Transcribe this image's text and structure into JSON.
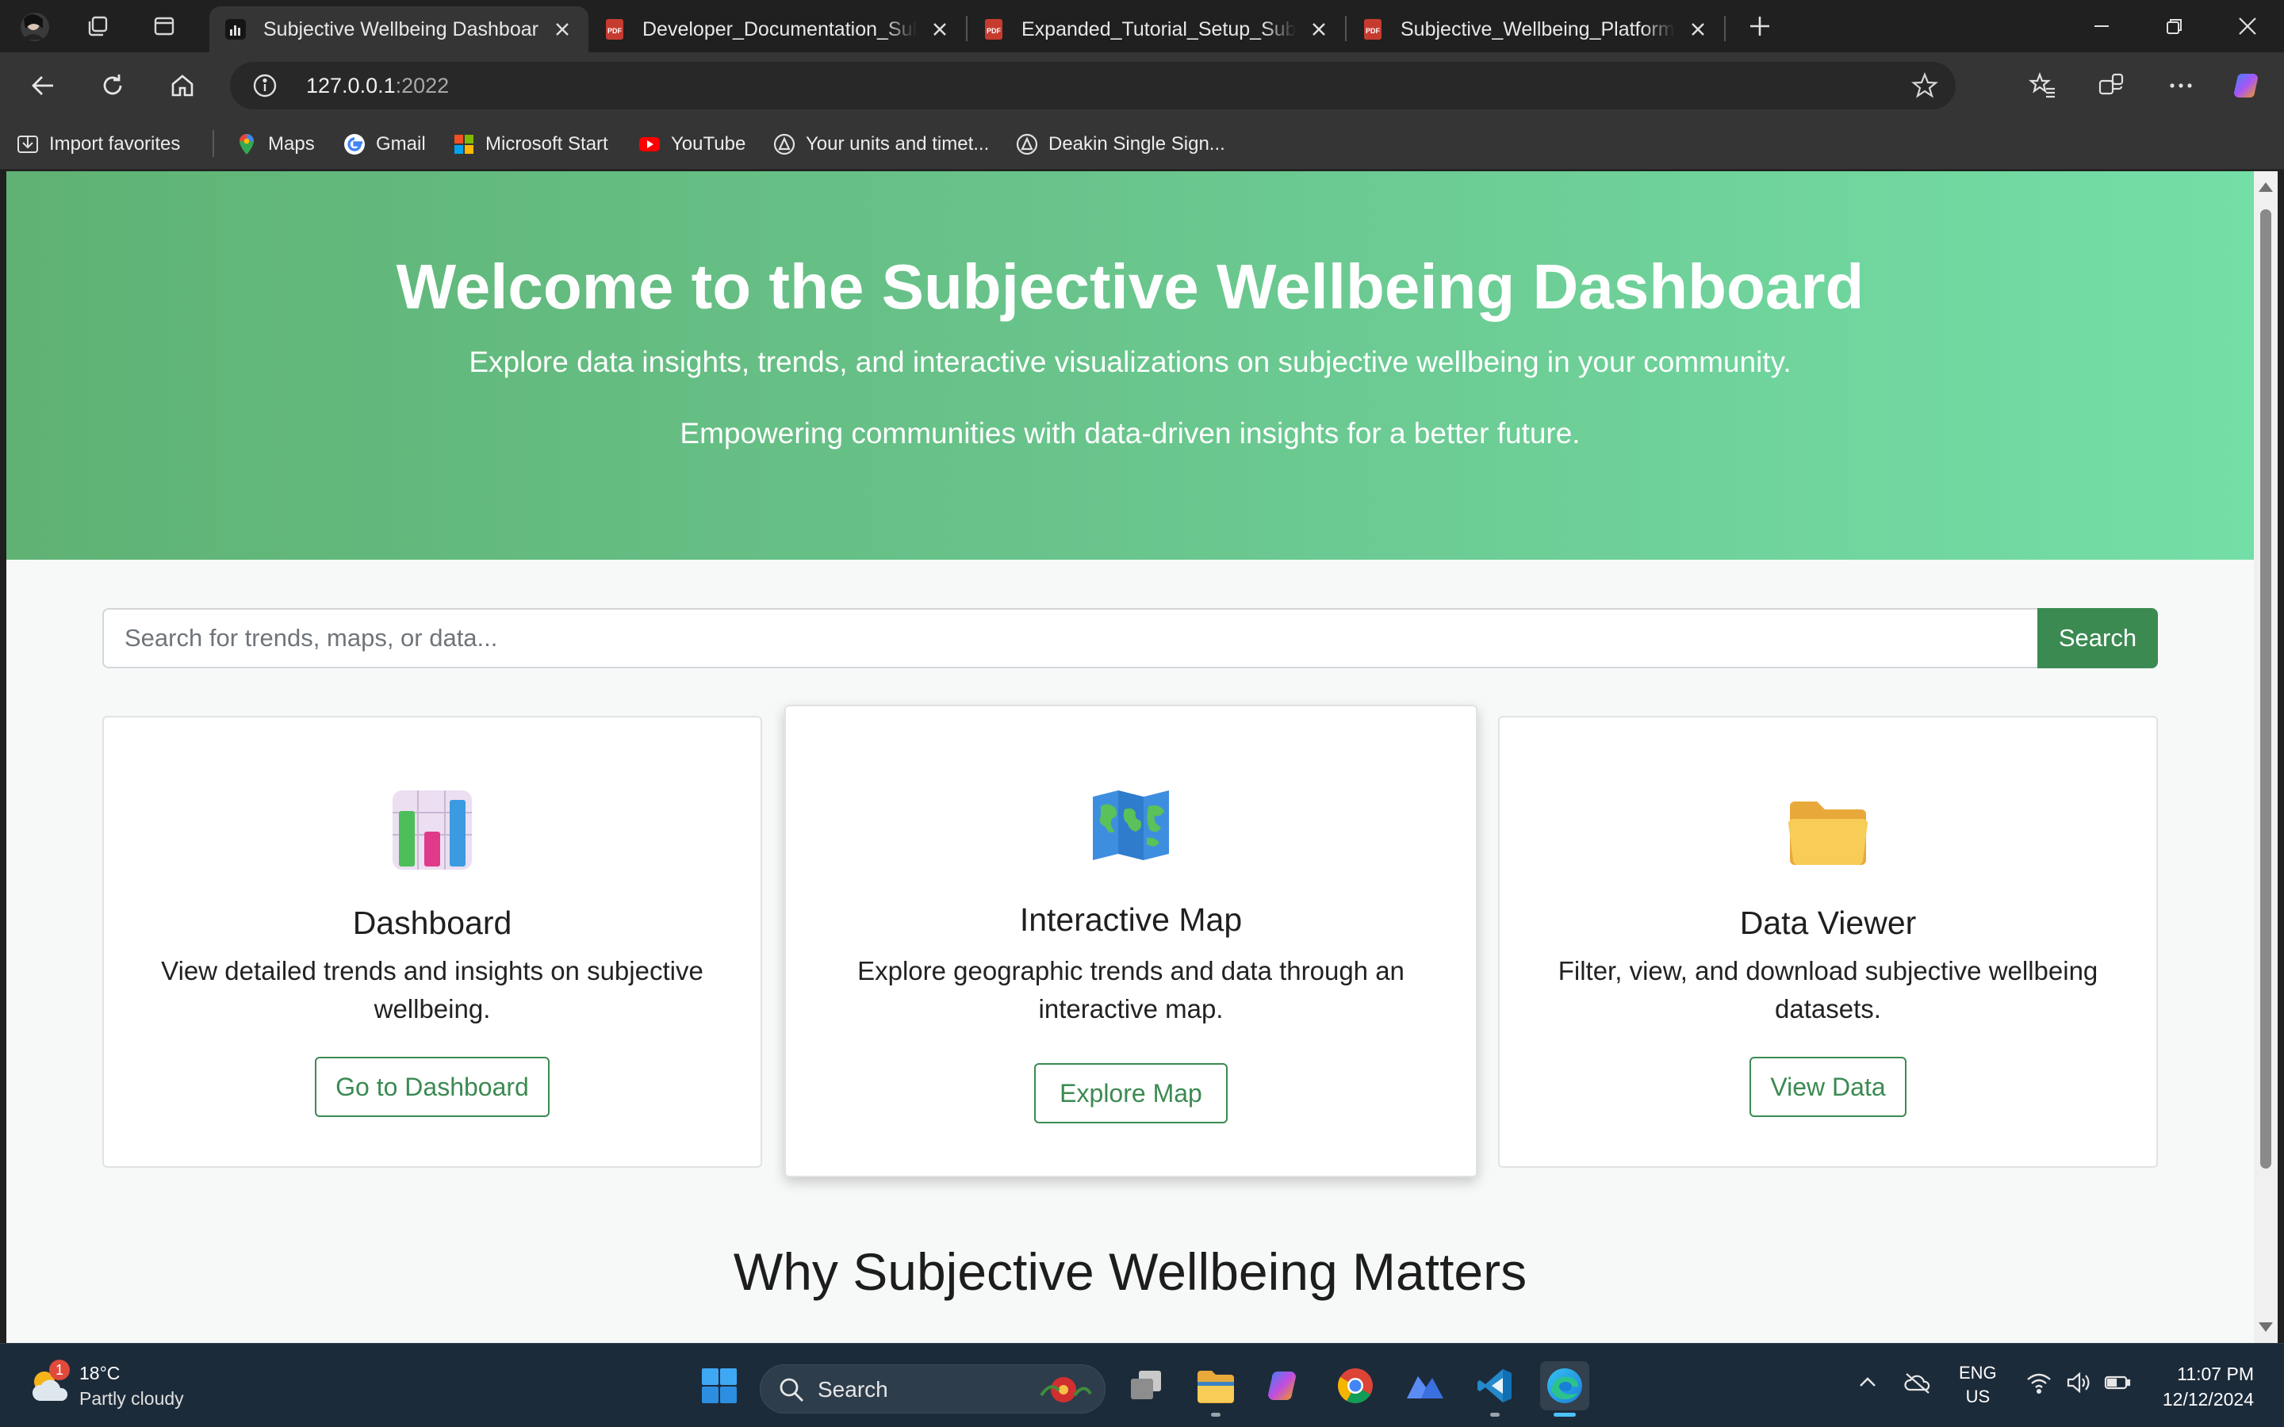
{
  "browser": {
    "tabs": [
      {
        "title": "Subjective Wellbeing Dashboard",
        "active": true
      },
      {
        "title": "Developer_Documentation_Subje",
        "active": false
      },
      {
        "title": "Expanded_Tutorial_Setup_Subject",
        "active": false
      },
      {
        "title": "Subjective_Wellbeing_Platform_Us",
        "active": false
      }
    ],
    "address": {
      "host": "127.0.0.1",
      "port": ":2022"
    },
    "bookmarks": [
      {
        "label": "Import favorites",
        "icon": "import-icon"
      },
      {
        "label": "Maps",
        "icon": "maps-icon"
      },
      {
        "label": "Gmail",
        "icon": "google-icon"
      },
      {
        "label": "Microsoft Start",
        "icon": "microsoft-icon"
      },
      {
        "label": "YouTube",
        "icon": "youtube-icon"
      },
      {
        "label": "Your units and timet...",
        "icon": "deakin-icon"
      },
      {
        "label": "Deakin Single Sign...",
        "icon": "deakin-icon"
      }
    ]
  },
  "page": {
    "hero": {
      "title": "Welcome to the Subjective Wellbeing Dashboard",
      "subtitle": "Explore data insights, trends, and interactive visualizations on subjective wellbeing in your community.",
      "tagline": "Empowering communities with data-driven insights for a better future."
    },
    "search": {
      "placeholder": "Search for trends, maps, or data...",
      "button": "Search"
    },
    "cards": [
      {
        "title": "Dashboard",
        "desc": "View detailed trends and insights on subjective wellbeing.",
        "button": "Go to Dashboard",
        "icon": "bar-chart-icon"
      },
      {
        "title": "Interactive Map",
        "desc": "Explore geographic trends and data through an interactive map.",
        "button": "Explore Map",
        "icon": "world-map-icon"
      },
      {
        "title": "Data Viewer",
        "desc": "Filter, view, and download subjective wellbeing datasets.",
        "button": "View Data",
        "icon": "folder-icon"
      }
    ],
    "section_heading": "Why Subjective Wellbeing Matters"
  },
  "taskbar": {
    "weather": {
      "temp": "18°C",
      "condition": "Partly cloudy",
      "badge": "1"
    },
    "search_label": "Search",
    "language": {
      "line1": "ENG",
      "line2": "US"
    },
    "clock": {
      "time": "11:07 PM",
      "date": "12/12/2024"
    }
  },
  "colors": {
    "accent_green": "#3b8a52",
    "hero_start": "#5fb274",
    "hero_end": "#74dea7"
  }
}
